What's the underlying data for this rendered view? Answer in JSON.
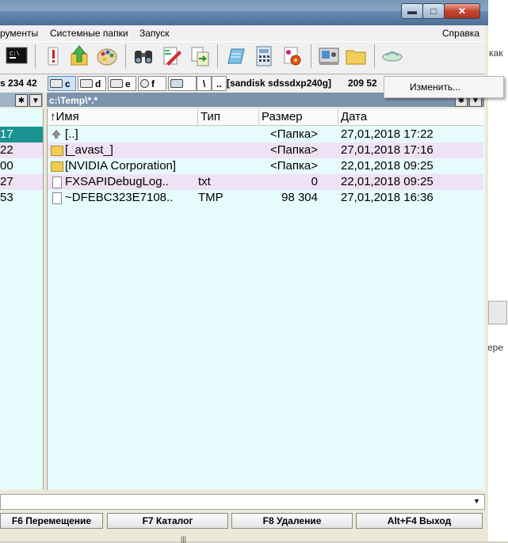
{
  "window": {
    "min_glyph": "▬",
    "max_glyph": "□",
    "close_glyph": "✕"
  },
  "menu": {
    "items": [
      "рументы",
      "Системные папки",
      "Запуск"
    ],
    "help": "Справка"
  },
  "desktop_edge": {
    "text1": "как",
    "text2": "ере"
  },
  "drivebar": {
    "free_left": "s 234 42",
    "drives": [
      "c",
      "d",
      "e",
      "f"
    ],
    "root": "\\",
    "up": "..",
    "label": "[sandisk sdssdxp240g]",
    "free_right": "209 52"
  },
  "popup": {
    "item": "Изменить..."
  },
  "panel": {
    "path": "c:\\Temp\\*.*",
    "star_btn": "✱",
    "dropdown_btn": "▼"
  },
  "left_panel": {
    "rows": [
      "17",
      "22",
      "00",
      "27",
      "53"
    ],
    "highlight_color": "#1a9393"
  },
  "columns": {
    "name": "↑Имя",
    "type": "Тип",
    "size": "Размер",
    "date": "Дата"
  },
  "files": [
    {
      "name": "[..]",
      "type": "",
      "size": "<Папка>",
      "date": "27,01,2018 17:22",
      "icon": "up-arrow-icon"
    },
    {
      "name": "[_avast_]",
      "type": "",
      "size": "<Папка>",
      "date": "27,01,2018 17:16",
      "icon": "folder-icon"
    },
    {
      "name": "[NVIDIA Corporation]",
      "type": "",
      "size": "<Папка>",
      "date": "22,01,2018 09:25",
      "icon": "folder-icon"
    },
    {
      "name": "FXSAPIDebugLog..",
      "type": "txt",
      "size": "0",
      "date": "22,01,2018 09:25",
      "icon": "file-icon"
    },
    {
      "name": "~DFEBC323E7108..",
      "type": "TMP",
      "size": "98 304",
      "date": "27,01,2018 16:36",
      "icon": "file-icon"
    }
  ],
  "fkeys": [
    "F6 Перемещение",
    "F7 Каталог",
    "F8 Удаление",
    "Alt+F4 Выход"
  ],
  "colors": {
    "panel_bg": "#e6fbfb",
    "pink_row": "#f0e2f6",
    "path_header": "#7d93ad"
  }
}
